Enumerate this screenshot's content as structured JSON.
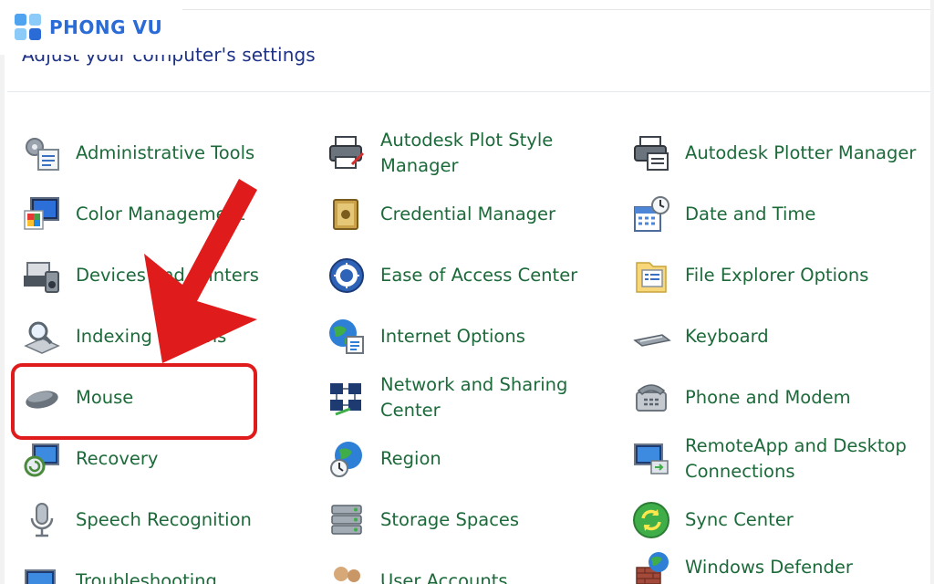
{
  "brand": {
    "name": "PHONG VU"
  },
  "header": {
    "title": "Adjust your computer's settings"
  },
  "colors": {
    "accent": "#1c6a3a",
    "heading": "#1e3287",
    "highlight": "#e01b1b",
    "brand": "#2b6bd6"
  },
  "columns": [
    {
      "items": [
        {
          "label": "Administrative Tools",
          "icon": "admin-tools-icon"
        },
        {
          "label": "Color Management",
          "icon": "color-management-icon"
        },
        {
          "label": "Devices and Printers",
          "icon": "devices-printers-icon"
        },
        {
          "label": "Indexing Options",
          "icon": "indexing-options-icon"
        },
        {
          "label": "Mouse",
          "icon": "mouse-icon"
        },
        {
          "label": "Recovery",
          "icon": "recovery-icon"
        },
        {
          "label": "Speech Recognition",
          "icon": "speech-recognition-icon"
        },
        {
          "label": "Troubleshooting",
          "icon": "troubleshooting-icon"
        }
      ]
    },
    {
      "items": [
        {
          "label": "Autodesk Plot Style Manager",
          "icon": "autodesk-plot-style-icon"
        },
        {
          "label": "Credential Manager",
          "icon": "credential-manager-icon"
        },
        {
          "label": "Ease of Access Center",
          "icon": "ease-of-access-icon"
        },
        {
          "label": "Internet Options",
          "icon": "internet-options-icon"
        },
        {
          "label": "Network and Sharing Center",
          "icon": "network-sharing-icon"
        },
        {
          "label": "Region",
          "icon": "region-icon"
        },
        {
          "label": "Storage Spaces",
          "icon": "storage-spaces-icon"
        },
        {
          "label": "User Accounts",
          "icon": "user-accounts-icon"
        }
      ]
    },
    {
      "items": [
        {
          "label": "Autodesk Plotter Manager",
          "icon": "autodesk-plotter-icon"
        },
        {
          "label": "Date and Time",
          "icon": "date-time-icon"
        },
        {
          "label": "File Explorer Options",
          "icon": "file-explorer-options-icon"
        },
        {
          "label": "Keyboard",
          "icon": "keyboard-icon"
        },
        {
          "label": "Phone and Modem",
          "icon": "phone-modem-icon"
        },
        {
          "label": "RemoteApp and Desktop Connections",
          "icon": "remoteapp-icon"
        },
        {
          "label": "Sync Center",
          "icon": "sync-center-icon"
        },
        {
          "label": "Windows Defender",
          "icon": "windows-defender-icon"
        }
      ]
    }
  ]
}
